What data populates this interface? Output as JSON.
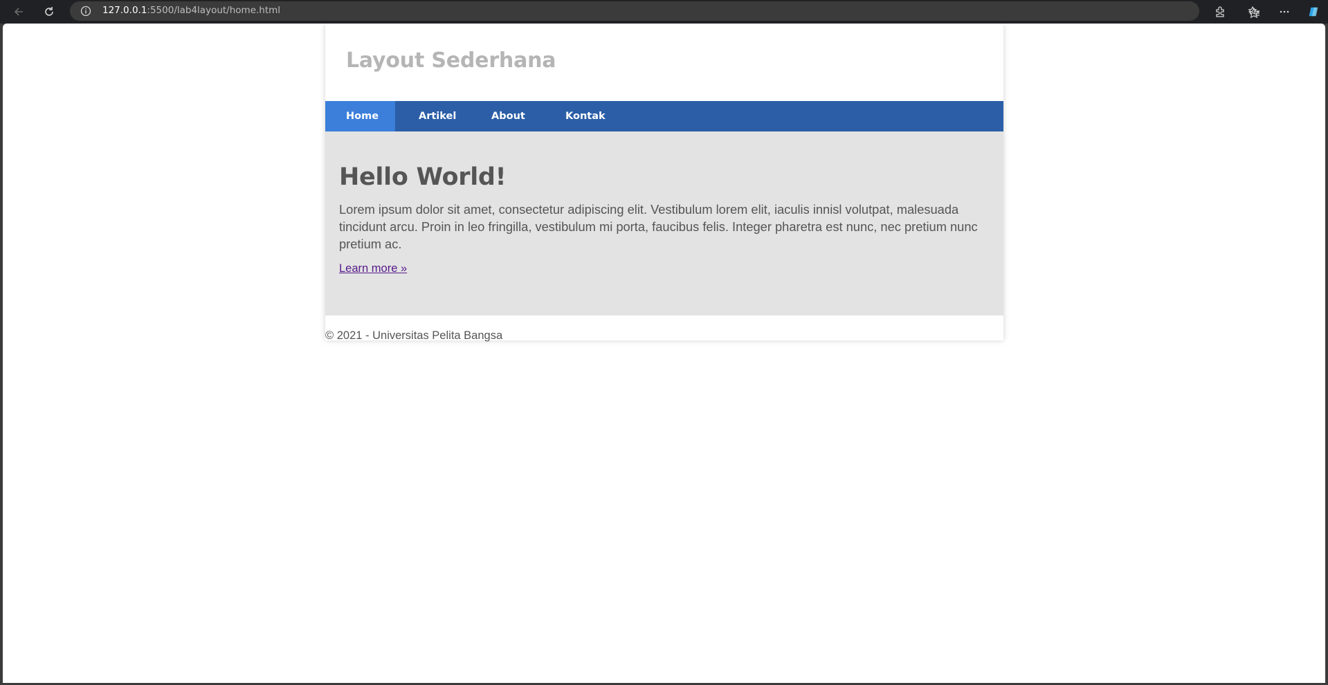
{
  "browser": {
    "url_host": "127.0.0.1",
    "url_path": ":5500/lab4layout/home.html",
    "icons": [
      "back-arrow-icon",
      "reload-icon",
      "info-icon",
      "star-icon",
      "extensions-icon",
      "favorites-icon",
      "more-icon",
      "copilot-icon"
    ]
  },
  "site": {
    "title": "Layout Sederhana",
    "nav": {
      "home": "Home",
      "artikel": "Artikel",
      "about": "About",
      "kontak": "Kontak"
    },
    "hero": {
      "heading": "Hello World!",
      "body": "Lorem ipsum dolor sit amet, consectetur adipiscing elit. Vestibulum lorem elit, iaculis innisl volutpat, malesuada tincidunt arcu. Proin in leo fringilla, vestibulum mi porta, faucibus felis. Integer pharetra est nunc, nec pretium nunc pretium ac.",
      "link": "Learn more »"
    },
    "footer": "© 2021 - Universitas Pelita Bangsa"
  },
  "colors": {
    "nav_bg": "#2b5ea7",
    "nav_active": "#3c7fdb",
    "hero_bg": "#e3e3e3",
    "title": "#b5b5b5",
    "text": "#555555"
  }
}
